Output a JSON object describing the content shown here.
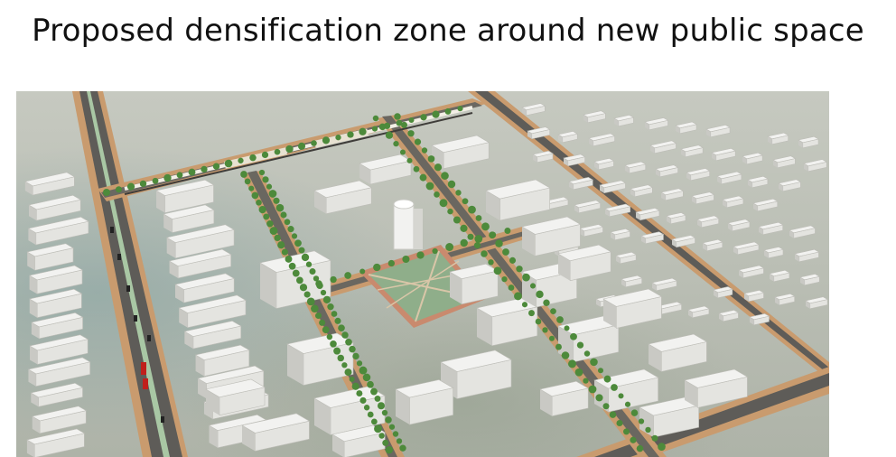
{
  "slide": {
    "title": "Proposed densification zone around new public space"
  },
  "image": {
    "subject": "aerial-3d-massing-model",
    "colors": {
      "ground": "#b7bbb0",
      "road": "#5e5c58",
      "road_edge": "#c99b6e",
      "buildings": "#f2f2f0",
      "building_shadow": "#c9c9c4",
      "trees": "#4d8a3b",
      "plaza": "#8fae8a",
      "plaza_paving": "#c98a6e",
      "vehicles_red": "#c0201c"
    }
  }
}
